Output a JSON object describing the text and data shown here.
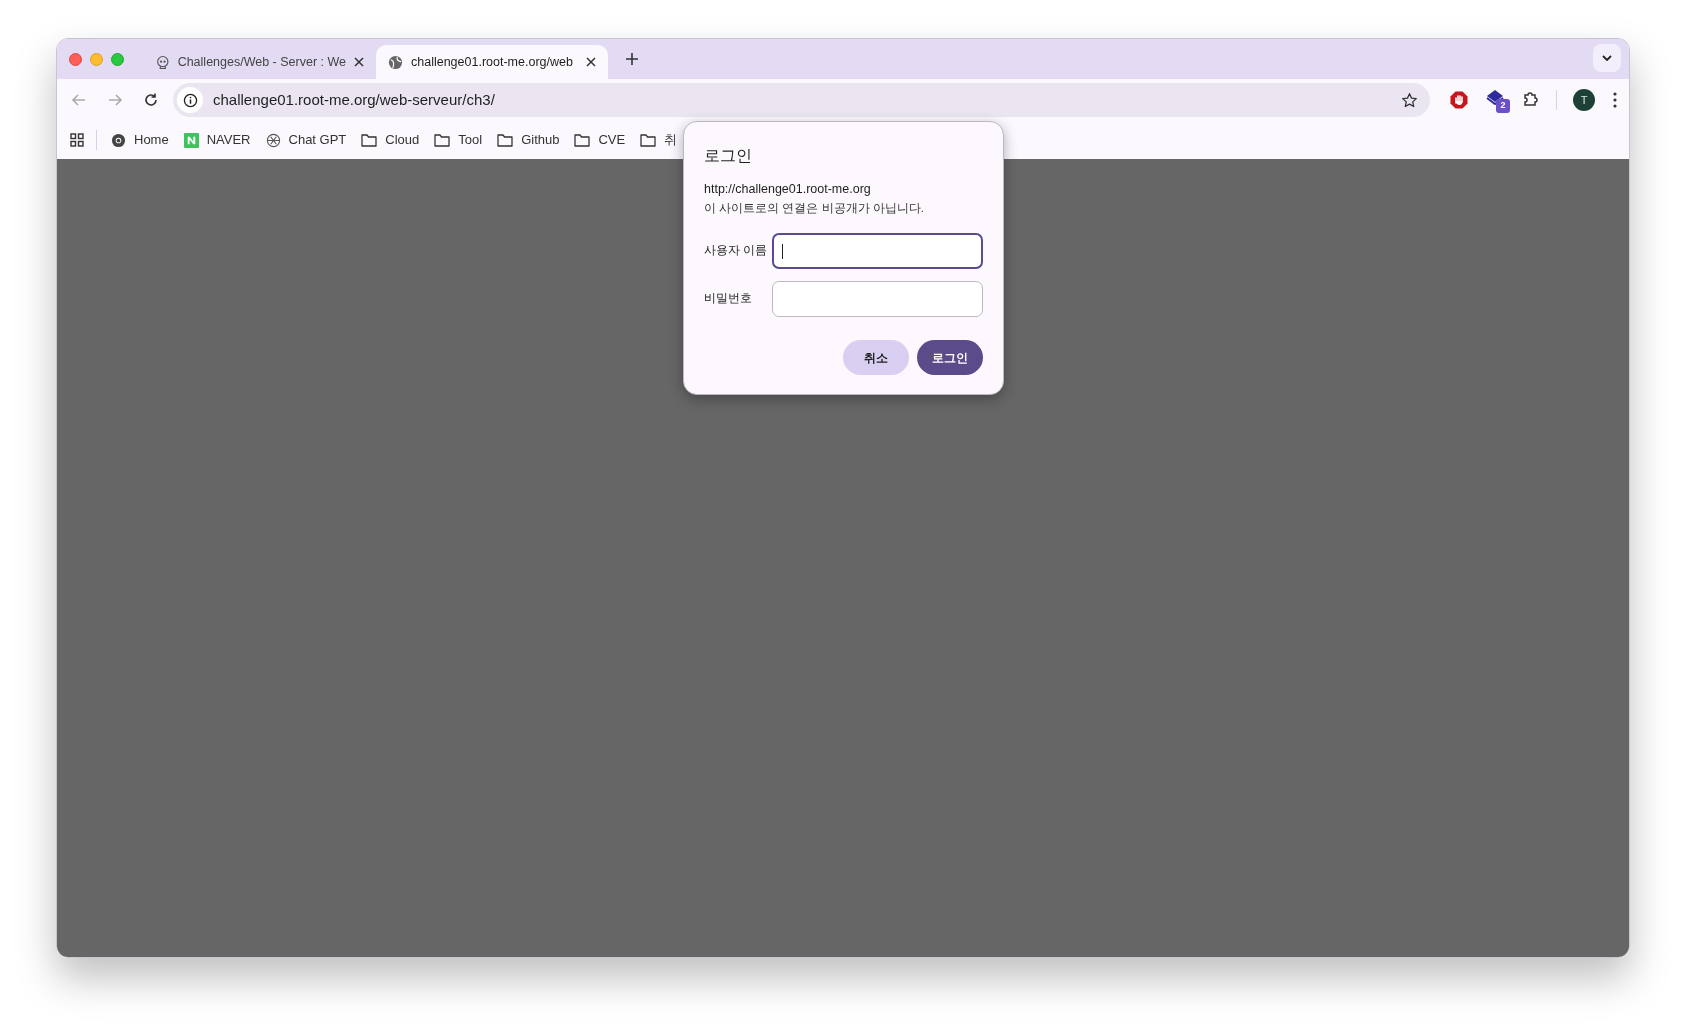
{
  "tabs": [
    {
      "title": "Challenges/Web - Server : We",
      "selected": false
    },
    {
      "title": "challenge01.root-me.org/web",
      "selected": true
    }
  ],
  "address_bar": {
    "url": "challenge01.root-me.org/web-serveur/ch3/"
  },
  "extensions": {
    "badge": "2"
  },
  "profile": {
    "initial": "T"
  },
  "bookmarks": [
    {
      "label": "Home",
      "kind": "page"
    },
    {
      "label": "NAVER",
      "kind": "page"
    },
    {
      "label": "Chat GPT",
      "kind": "page"
    },
    {
      "label": "Cloud",
      "kind": "folder"
    },
    {
      "label": "Tool",
      "kind": "folder"
    },
    {
      "label": "Github",
      "kind": "folder"
    },
    {
      "label": "CVE",
      "kind": "folder"
    },
    {
      "label": "취",
      "kind": "folder"
    }
  ],
  "dialog": {
    "title": "로그인",
    "origin": "http://challenge01.root-me.org",
    "note": "이 사이트로의 연결은 비공개가 아닙니다.",
    "fields": [
      {
        "label": "사용자 이름",
        "focused": true
      },
      {
        "label": "비밀번호",
        "focused": false
      }
    ],
    "buttons": [
      {
        "label": "취소",
        "kind": "secondary"
      },
      {
        "label": "로그인",
        "kind": "primary"
      }
    ]
  }
}
